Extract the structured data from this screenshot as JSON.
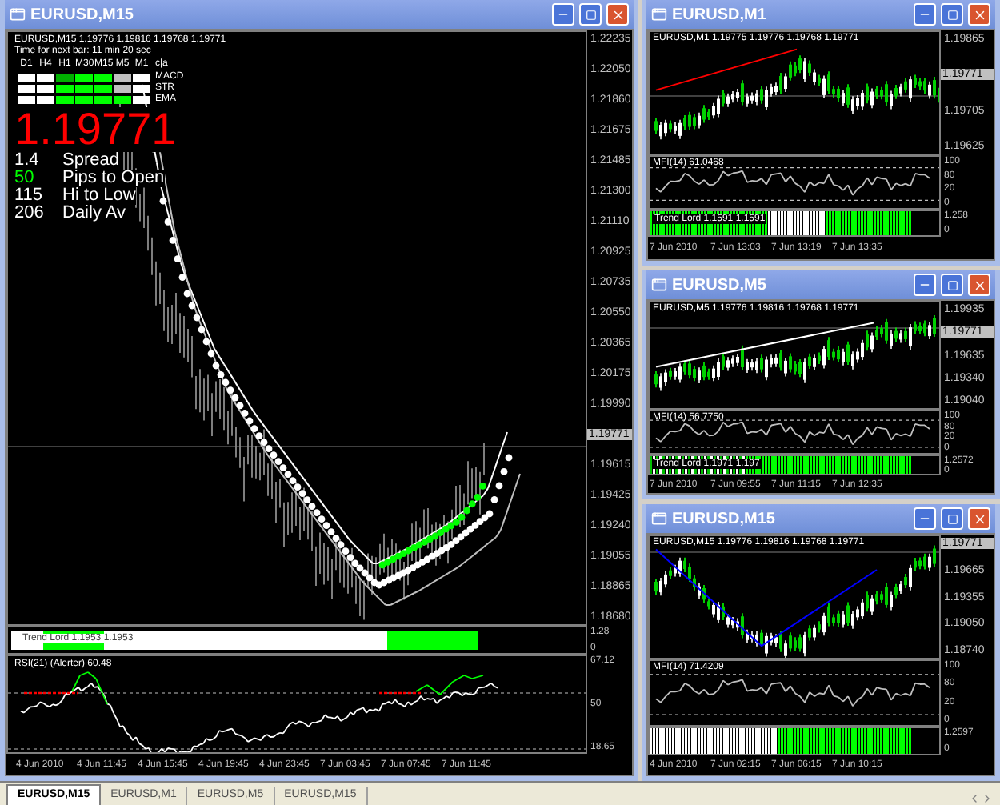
{
  "main_window": {
    "title": "EURUSD,M15",
    "header": "EURUSD,M15  1.19776 1.19816 1.19768 1.19771",
    "timer": "Time for next bar: 11 min 20 sec",
    "timeframes": [
      "D1",
      "H4",
      "H1",
      "M30",
      "M15",
      "M5",
      "M1"
    ],
    "signal_caption": "c|a",
    "signal_rows": [
      {
        "label": "MACD",
        "cells": [
          {
            "color": "#ffffff"
          },
          {
            "color": "#ffffff"
          },
          {
            "color": "#00b000"
          },
          {
            "color": "#00ff00"
          },
          {
            "color": "#00ff00"
          },
          {
            "color": "#c0c0c0"
          },
          {
            "color": "#ffffff"
          }
        ]
      },
      {
        "label": "STR",
        "cells": [
          {
            "color": "#ffffff"
          },
          {
            "color": "#ffffff"
          },
          {
            "color": "#00ff00"
          },
          {
            "color": "#00ff00"
          },
          {
            "color": "#00ff00"
          },
          {
            "color": "#c0c0c0"
          },
          {
            "color": "#ffffff"
          }
        ]
      },
      {
        "label": "EMA",
        "cells": [
          {
            "color": "#ffffff"
          },
          {
            "color": "#ffffff"
          },
          {
            "color": "#00ff00"
          },
          {
            "color": "#00ff00"
          },
          {
            "color": "#00ff00"
          },
          {
            "color": "#00ff00"
          },
          {
            "color": "#ffffff"
          }
        ]
      }
    ],
    "price": "1.19771",
    "stats": [
      {
        "value": "1.4",
        "label": "Spread",
        "color": "#ffffff"
      },
      {
        "value": "50",
        "label": "Pips to Open",
        "color": "#00ff00"
      },
      {
        "value": "115",
        "label": "Hi to Low",
        "color": "#ffffff"
      },
      {
        "value": "206",
        "label": "Daily Av",
        "color": "#ffffff"
      }
    ],
    "price_axis": [
      {
        "kind": "tick",
        "label": "1.22235"
      },
      {
        "kind": "tick",
        "label": "1.22050"
      },
      {
        "kind": "tick",
        "label": "1.21860"
      },
      {
        "kind": "tick",
        "label": "1.21675"
      },
      {
        "kind": "tick",
        "label": "1.21485"
      },
      {
        "kind": "tick",
        "label": "1.21300"
      },
      {
        "kind": "tick",
        "label": "1.21110"
      },
      {
        "kind": "tick",
        "label": "1.20925"
      },
      {
        "kind": "tick",
        "label": "1.20735"
      },
      {
        "kind": "tick",
        "label": "1.20550"
      },
      {
        "kind": "tick",
        "label": "1.20365"
      },
      {
        "kind": "tick",
        "label": "1.20175"
      },
      {
        "kind": "tick",
        "label": "1.19990"
      },
      {
        "kind": "current",
        "label": "1.19771"
      },
      {
        "kind": "tick",
        "label": "1.19615"
      },
      {
        "kind": "tick",
        "label": "1.19425"
      },
      {
        "kind": "tick",
        "label": "1.19240"
      },
      {
        "kind": "tick",
        "label": "1.19055"
      },
      {
        "kind": "tick",
        "label": "1.18865"
      },
      {
        "kind": "tick",
        "label": "1.18680"
      }
    ],
    "trend_lord": {
      "label": "Trend Lord 1.1953 1.1953",
      "axis": [
        "1.28",
        "0"
      ]
    },
    "rsi": {
      "label": "RSI(21) (Alerter) 60.48",
      "axis": [
        "67.12",
        "50",
        "18.65"
      ]
    },
    "time_axis": [
      "4 Jun 2010",
      "4 Jun 11:45",
      "4 Jun 15:45",
      "4 Jun 19:45",
      "4 Jun 23:45",
      "7 Jun 03:45",
      "7 Jun 07:45",
      "7 Jun 11:45"
    ]
  },
  "windows": [
    {
      "title": "EURUSD,M1",
      "header": "EURUSD,M1  1.19775 1.19776 1.19768 1.19771",
      "color": "#ff0000",
      "price_axis": [
        {
          "kind": "tick",
          "label": "1.19865"
        },
        {
          "kind": "current",
          "label": "1.19771"
        },
        {
          "kind": "tick",
          "label": "1.19705"
        },
        {
          "kind": "tick",
          "label": "1.19625"
        }
      ],
      "mfi_label": "MFI(14) 61.0468",
      "mfi_axis": [
        "100",
        "80",
        "20",
        "0"
      ],
      "bars_label": "Trend Lord 1.1591 1.1591",
      "bars_axis": [
        "1.258",
        "0"
      ],
      "time_axis": [
        "7 Jun 2010",
        "7 Jun 13:03",
        "7 Jun 13:19",
        "7 Jun 13:35"
      ]
    },
    {
      "title": "EURUSD,M5",
      "header": "EURUSD,M5  1.19776 1.19816 1.19768 1.19771",
      "color": "#ffffff",
      "price_axis": [
        {
          "kind": "tick",
          "label": "1.19935"
        },
        {
          "kind": "current",
          "label": "1.19771"
        },
        {
          "kind": "tick",
          "label": "1.19635"
        },
        {
          "kind": "tick",
          "label": "1.19340"
        },
        {
          "kind": "tick",
          "label": "1.19040"
        }
      ],
      "mfi_label": "MFI(14) 56.7750",
      "mfi_axis": [
        "100",
        "80",
        "20",
        "0"
      ],
      "bars_label": "Trend Lord 1.1971 1.197",
      "bars_axis": [
        "1.2572",
        "0"
      ],
      "time_axis": [
        "7 Jun 2010",
        "7 Jun 09:55",
        "7 Jun 11:15",
        "7 Jun 12:35"
      ]
    },
    {
      "title": "EURUSD,M15",
      "header": "EURUSD,M15  1.19776 1.19816 1.19768 1.19771",
      "color": "#0000ff",
      "price_axis": [
        {
          "kind": "current",
          "label": "1.19771"
        },
        {
          "kind": "tick",
          "label": "1.19665"
        },
        {
          "kind": "tick",
          "label": "1.19355"
        },
        {
          "kind": "tick",
          "label": "1.19050"
        },
        {
          "kind": "tick",
          "label": "1.18740"
        }
      ],
      "mfi_label": "MFI(14) 71.4209",
      "mfi_axis": [
        "100",
        "80",
        "20",
        "0"
      ],
      "bars_axis": [
        "1.2597",
        "0"
      ],
      "time_axis": [
        "4 Jun 2010",
        "7 Jun 02:15",
        "7 Jun 06:15",
        "7 Jun 10:15"
      ]
    }
  ],
  "tabs": [
    {
      "label": "EURUSD,M15",
      "selected": true
    },
    {
      "label": "EURUSD,M1",
      "selected": false
    },
    {
      "label": "EURUSD,M5",
      "selected": false
    },
    {
      "label": "EURUSD,M15",
      "selected": false
    }
  ]
}
